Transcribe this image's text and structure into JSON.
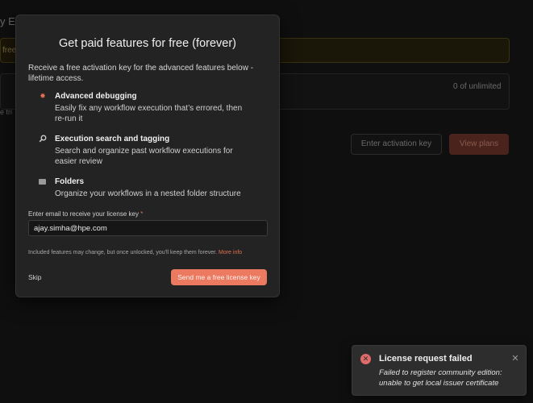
{
  "background": {
    "title_fragment": "y Ec",
    "banner_fragment": "free",
    "usage_text": "0 of unlimited",
    "side_fragment": "e tri",
    "activation_button_label": "Enter activation key",
    "plans_button_label": "View plans"
  },
  "modal": {
    "title": "Get paid features for free (forever)",
    "intro": "Receive a free activation key for the advanced features below - lifetime access.",
    "features": [
      {
        "icon": "bug-icon",
        "title": "Advanced debugging",
        "description": "Easily fix any workflow execution that’s errored, then re-run it"
      },
      {
        "icon": "magnifier-icon",
        "title": "Execution search and tagging",
        "description": "Search and organize past workflow executions for easier review"
      },
      {
        "icon": "folder-icon",
        "title": "Folders",
        "description": "Organize your workflows in a nested folder structure"
      }
    ],
    "email_label": "Enter email to receive your license key",
    "email_required_mark": "*",
    "email_value": "ajay.simha@hpe.com",
    "note": "Included features may change, but once unlocked, you'll keep them forever.",
    "note_link": "More info",
    "skip_label": "Skip",
    "submit_label": "Send me a free license key"
  },
  "toast": {
    "title": "License request failed",
    "message": "Failed to register community edition: unable to get local issuer certificate",
    "icon": "error-icon",
    "close_icon": "close-icon"
  },
  "colors": {
    "accent": "#ec7a61",
    "error": "#e06b6b",
    "modal_bg": "#232323",
    "page_bg": "#0f0f0f"
  }
}
